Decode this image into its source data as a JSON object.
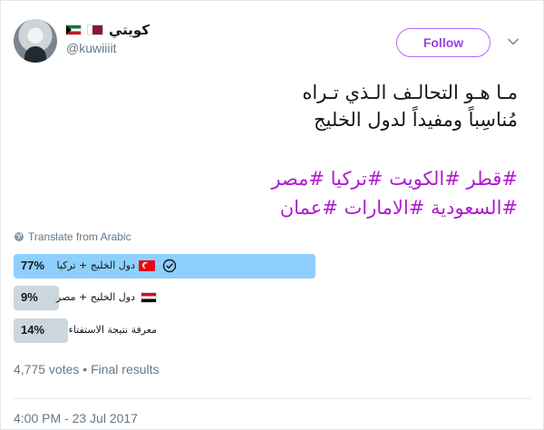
{
  "user": {
    "display_name": "كويتي",
    "handle": "@kuwiiiit",
    "flags": [
      "kuwait",
      "qatar"
    ]
  },
  "follow_button": {
    "label": "Follow"
  },
  "tweet": {
    "lines": [
      "مـا هـو التحالـف الـذي تـراه",
      "مُناسِباً ومفيداً لدول الخليج"
    ],
    "hashtag_lines": [
      [
        "#قطر",
        "#الكويت",
        "#تركيا",
        "#مصر"
      ],
      [
        "#السعودية",
        "#الامارات",
        "#عمان"
      ]
    ]
  },
  "translate_label": "Translate from Arabic",
  "poll": {
    "options": [
      {
        "percent_label": "77%",
        "percent": 77,
        "label": "دول الخليج + تركيا",
        "flag": "turkey",
        "winner": true
      },
      {
        "percent_label": "9%",
        "percent": 9,
        "label": "دول الخليج + مصر",
        "flag": "egypt",
        "winner": false
      },
      {
        "percent_label": "14%",
        "percent": 14,
        "label": "معرفة نتيجة الاستفتاء",
        "flag": "",
        "winner": false
      }
    ],
    "votes_text": "4,775 votes • Final results"
  },
  "timestamp": "4:00 PM - 23 Jul 2017",
  "colors": {
    "accent": "#9a3fe0",
    "hashtag": "#b01ad0",
    "winner_bar": "#8ed0fb",
    "loser_bar": "#ccd6dd",
    "muted": "#657786"
  }
}
